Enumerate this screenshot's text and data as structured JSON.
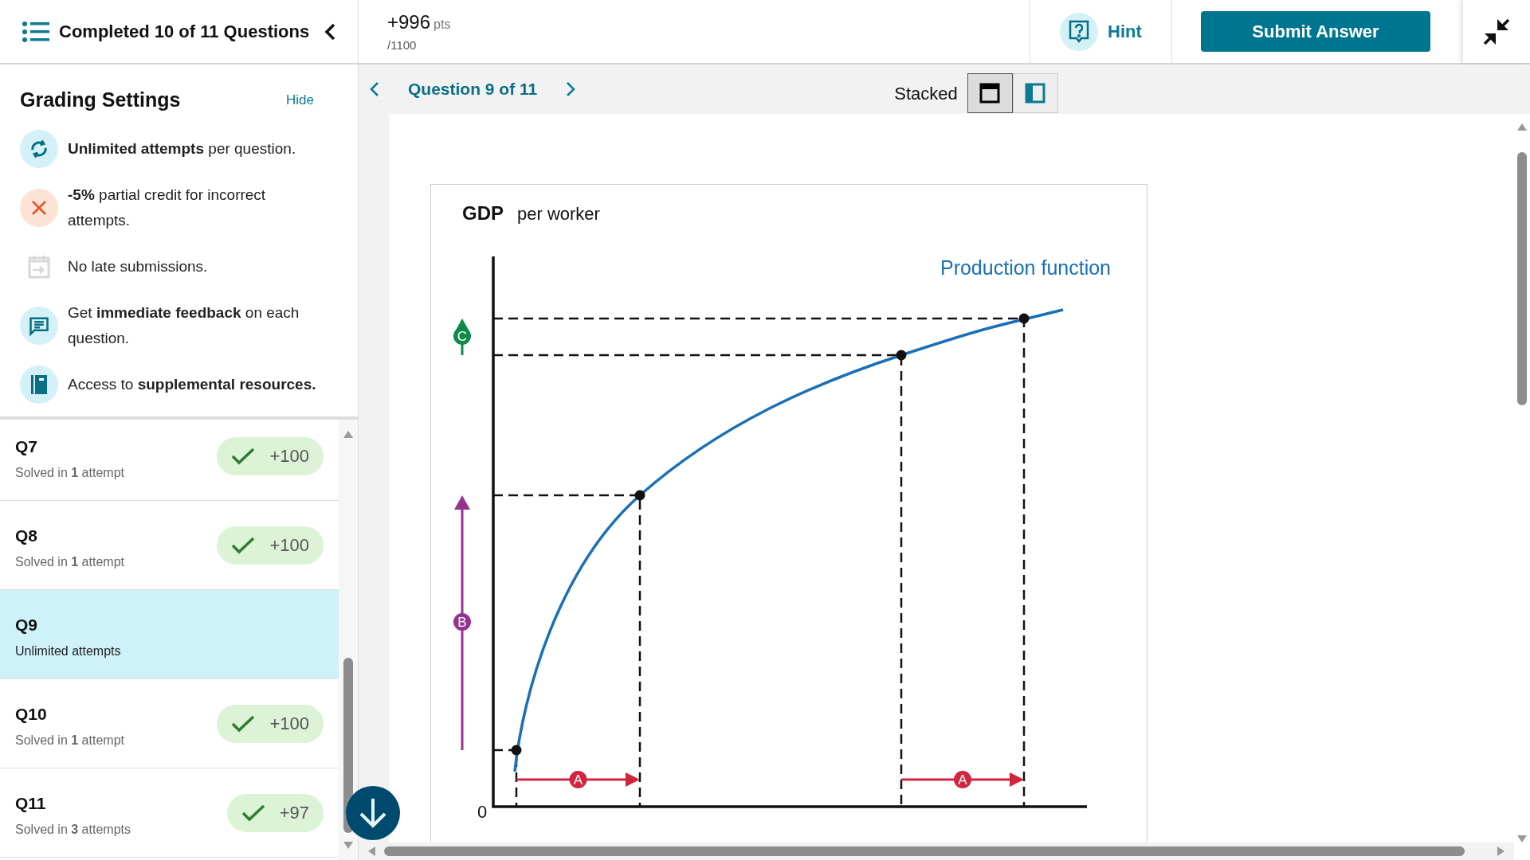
{
  "header": {
    "title": "Completed 10 of 11 Questions",
    "score": "+996",
    "score_unit": "pts",
    "total": "/1100",
    "hint": "Hint",
    "submit": "Submit Answer"
  },
  "grading": {
    "title": "Grading Settings",
    "hide": "Hide",
    "items": [
      {
        "kind": "refresh",
        "text": "**Unlimited attempts** per question."
      },
      {
        "kind": "penalty",
        "text": "**-5%** partial credit for incorrect attempts."
      },
      {
        "kind": "calendar",
        "text": "No late submissions."
      },
      {
        "kind": "feedback",
        "text": "Get **immediate feedback** on each question."
      },
      {
        "kind": "book",
        "text": "Access to **supplemental resources.**"
      }
    ]
  },
  "questions": [
    {
      "label": "Q7",
      "status": "Solved in **1** attempt",
      "points": "+100",
      "selected": false
    },
    {
      "label": "Q8",
      "status": "Solved in **1** attempt",
      "points": "+100",
      "selected": false
    },
    {
      "label": "Q9",
      "status": "Unlimited attempts",
      "selected": true
    },
    {
      "label": "Q10",
      "status": "Solved in **1** attempt",
      "points": "+100",
      "selected": false
    },
    {
      "label": "Q11",
      "status": "Solved in **3** attempts",
      "points": "+97",
      "selected": false
    }
  ],
  "nav": {
    "title": "Question 9 of 11"
  },
  "layout": {
    "label": "Stacked",
    "options": [
      {
        "kind": "stacked",
        "selected": true
      },
      {
        "kind": "side",
        "selected": false
      }
    ]
  },
  "graph": {
    "title": "GDP",
    "subtitle": "per worker",
    "curve_label": "Production function",
    "origin": "0",
    "markers": [
      {
        "letter": "A",
        "color": "#d0243f"
      },
      {
        "letter": "A",
        "color": "#d0243f"
      },
      {
        "letter": "B",
        "color": "#93348f"
      },
      {
        "letter": "C",
        "color": "#0f8a4a"
      }
    ]
  }
}
